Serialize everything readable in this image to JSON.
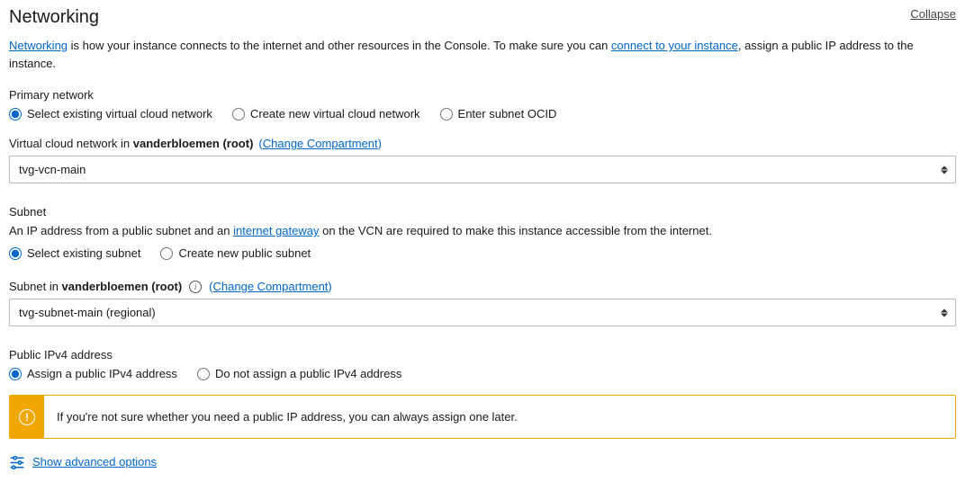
{
  "header": {
    "title": "Networking",
    "collapse": "Collapse"
  },
  "intro": {
    "link1_text": "Networking",
    "mid": " is how your instance connects to the internet and other resources in the Console. To make sure you can ",
    "link2_text": "connect to your instance",
    "tail": ", assign a public IP address to the instance."
  },
  "primary_network": {
    "label": "Primary network",
    "options": {
      "existing": "Select existing virtual cloud network",
      "create": "Create new virtual cloud network",
      "ocid": "Enter subnet OCID"
    }
  },
  "vcn": {
    "label_prefix": "Virtual cloud network in ",
    "compartment": "vanderbloemen (root)",
    "change_link": "Change Compartment",
    "value": "tvg-vcn-main"
  },
  "subnet_section": {
    "title": "Subnet",
    "intro_pre": "An IP address from a public subnet and an ",
    "intro_link": "internet gateway",
    "intro_post": " on the VCN are required to make this instance accessible from the internet.",
    "options": {
      "existing": "Select existing subnet",
      "create": "Create new public subnet"
    }
  },
  "subnet": {
    "label_prefix": "Subnet in ",
    "compartment": "vanderbloemen (root)",
    "change_link": "Change Compartment",
    "value": "tvg-subnet-main (regional)"
  },
  "public_ip": {
    "title": "Public IPv4 address",
    "options": {
      "assign": "Assign a public IPv4 address",
      "noassign": "Do not assign a public IPv4 address"
    }
  },
  "notice": {
    "text": "If you're not sure whether you need a public IP address, you can always assign one later."
  },
  "advanced": {
    "label": "Show advanced options"
  }
}
